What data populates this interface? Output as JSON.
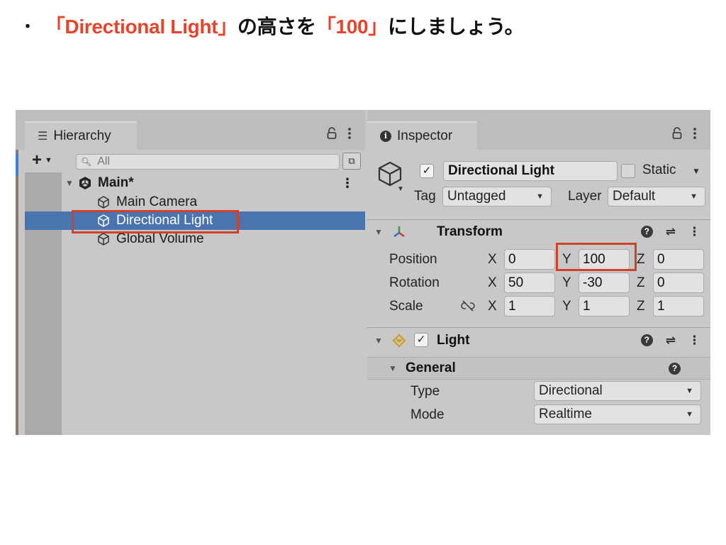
{
  "instruction": {
    "bullet": "・",
    "part1": "「Directional Light」",
    "part2": "の高さを",
    "part3": "「100」",
    "part4": "にしましょう。"
  },
  "colors": {
    "highlight_red": "#e8432b",
    "selection_blue": "#4a74b0",
    "panel_gray": "#c8c8c8"
  },
  "hierarchy": {
    "tab_label": "Hierarchy",
    "tab_icon": "list-icon",
    "search_placeholder": "All",
    "scene": {
      "name": "Main*",
      "icon": "unity-scene-icon"
    },
    "items": [
      {
        "label": "Main Camera",
        "icon": "gameobject-cube-icon",
        "selected": false
      },
      {
        "label": "Directional Light",
        "icon": "gameobject-cube-icon",
        "selected": true
      },
      {
        "label": "Global Volume",
        "icon": "gameobject-cube-icon",
        "selected": false
      }
    ]
  },
  "inspector": {
    "tab_label": "Inspector",
    "tab_icon": "info-icon",
    "gameobject": {
      "active": true,
      "name": "Directional Light",
      "static_label": "Static",
      "static": false,
      "tag_label": "Tag",
      "tag_value": "Untagged",
      "layer_label": "Layer",
      "layer_value": "Default"
    },
    "transform": {
      "title": "Transform",
      "axis_labels": {
        "x": "X",
        "y": "Y",
        "z": "Z"
      },
      "position": {
        "label": "Position",
        "x": "0",
        "y": "100",
        "z": "0"
      },
      "rotation": {
        "label": "Rotation",
        "x": "50",
        "y": "-30",
        "z": "0"
      },
      "scale": {
        "label": "Scale",
        "x": "1",
        "y": "1",
        "z": "1"
      }
    },
    "light": {
      "title": "Light",
      "enabled": true,
      "general_title": "General",
      "type_label": "Type",
      "type_value": "Directional",
      "mode_label": "Mode",
      "mode_value": "Realtime"
    }
  }
}
